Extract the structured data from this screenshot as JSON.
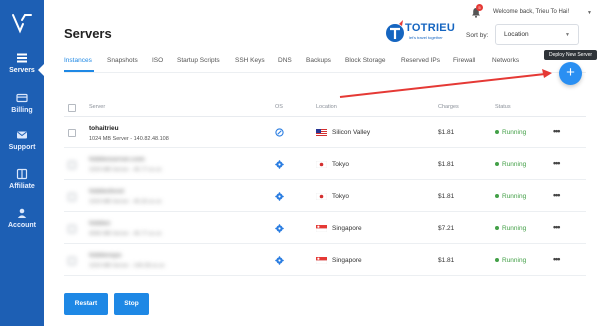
{
  "sidebar": {
    "logo_icon": "vultr-logo-icon",
    "items": [
      {
        "label": "Servers",
        "icon": "servers-icon"
      },
      {
        "label": "Billing",
        "icon": "billing-icon"
      },
      {
        "label": "Support",
        "icon": "support-icon"
      },
      {
        "label": "Affiliate",
        "icon": "affiliate-icon"
      },
      {
        "label": "Account",
        "icon": "account-icon"
      }
    ]
  },
  "header": {
    "title": "Servers",
    "brand_name": "TOTRIEU",
    "brand_tagline": "let's travel together",
    "notification_count": "5",
    "welcome": "Welcome back, Trieu To Hai!",
    "sort_label": "Sort by:",
    "sort_value": "Location"
  },
  "tabs": [
    "Instances",
    "Snapshots",
    "ISO",
    "Startup Scripts",
    "SSH Keys",
    "DNS",
    "Backups",
    "Block Storage",
    "Reserved IPs",
    "Firewall",
    "Networks"
  ],
  "tooltip": "Deploy New Server",
  "fab_label": "+",
  "table": {
    "columns": [
      "Server",
      "OS",
      "Location",
      "Charges",
      "Status"
    ],
    "rows": [
      {
        "name": "tohaitrieu",
        "details": "1024 MB Server - 140.82.48.108",
        "location": "Silicon Valley",
        "flag": "us-flag",
        "charges": "$1.81",
        "status": "Running"
      },
      {
        "name": "hiddenserver.com",
        "details": "1024 MB Server - 45.77.xx.xx",
        "location": "Tokyo",
        "flag": "jp-flag",
        "charges": "$1.81",
        "status": "Running"
      },
      {
        "name": "hiddenhost",
        "details": "1024 MB Server - 45.32.xx.xx",
        "location": "Tokyo",
        "flag": "jp-flag",
        "charges": "$1.81",
        "status": "Running"
      },
      {
        "name": "hidden",
        "details": "4096 MB Server - 45.77.xx.xx",
        "location": "Singapore",
        "flag": "sg-flag",
        "charges": "$7.21",
        "status": "Running"
      },
      {
        "name": "hiddenvps",
        "details": "1024 MB Server - 149.28.xx.xx",
        "location": "Singapore",
        "flag": "sg-flag",
        "charges": "$1.81",
        "status": "Running"
      }
    ]
  },
  "buttons": {
    "restart": "Restart",
    "stop": "Stop"
  },
  "colors": {
    "sidebar": "#1d5fb4",
    "accent": "#1e88e5",
    "running": "#43a047",
    "annotation_arrow": "#e53935"
  }
}
